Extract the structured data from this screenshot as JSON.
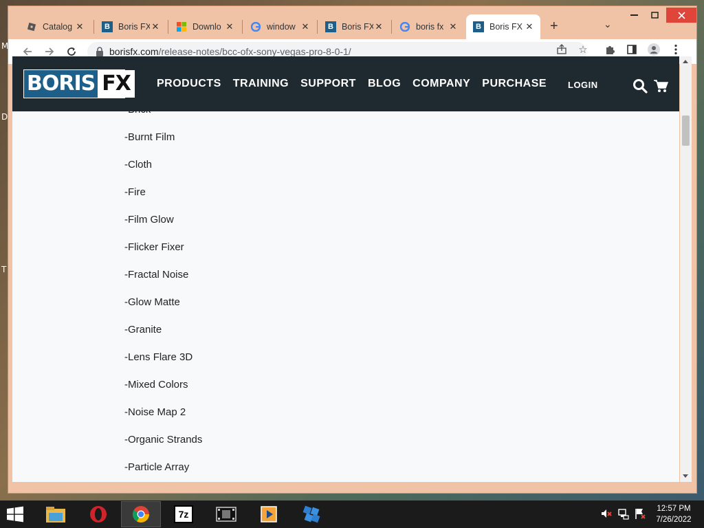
{
  "desktop": {
    "side_letters": [
      "M",
      "D",
      "T"
    ]
  },
  "browser": {
    "tabs": [
      {
        "title": "Catalog",
        "icon": "roblox-icon"
      },
      {
        "title": "Boris FX",
        "icon": "borisfx-icon"
      },
      {
        "title": "Downlo",
        "icon": "windows-logo-icon"
      },
      {
        "title": "window",
        "icon": "google-icon"
      },
      {
        "title": "Boris FX",
        "icon": "borisfx-icon"
      },
      {
        "title": "boris fx",
        "icon": "google-icon"
      },
      {
        "title": "Boris FX",
        "icon": "borisfx-icon",
        "active": true
      }
    ],
    "address": {
      "domain": "borisfx.com",
      "path": "/release-notes/bcc-ofx-sony-vegas-pro-8-0-1/"
    }
  },
  "site": {
    "logo": {
      "part1": "BORIS",
      "part2": "FX"
    },
    "nav": [
      "PRODUCTS",
      "TRAINING",
      "SUPPORT",
      "BLOG",
      "COMPANY",
      "PURCHASE"
    ],
    "login": "LOGIN",
    "effects": [
      "-Brick",
      "-Burnt Film",
      "-Cloth",
      "-Fire",
      "-Film Glow",
      "-Flicker Fixer",
      "-Fractal Noise",
      "-Glow Matte",
      "-Granite",
      "-Lens Flare 3D",
      "-Mixed Colors",
      "-Noise Map 2",
      "-Organic Strands",
      "-Particle Array"
    ]
  },
  "taskbar": {
    "apps": [
      "file-explorer-icon",
      "opera-icon",
      "chrome-icon",
      "7zip-icon",
      "video-editor-icon",
      "media-player-icon",
      "app-blue-icon"
    ],
    "sevenzip_label": "7z",
    "clock": {
      "time": "12:57 PM",
      "date": "7/26/2022"
    }
  },
  "colors": {
    "header_bg": "#1f2a30",
    "tabstrip": "#f0c2a6",
    "page_bg": "#f7f9fa"
  }
}
